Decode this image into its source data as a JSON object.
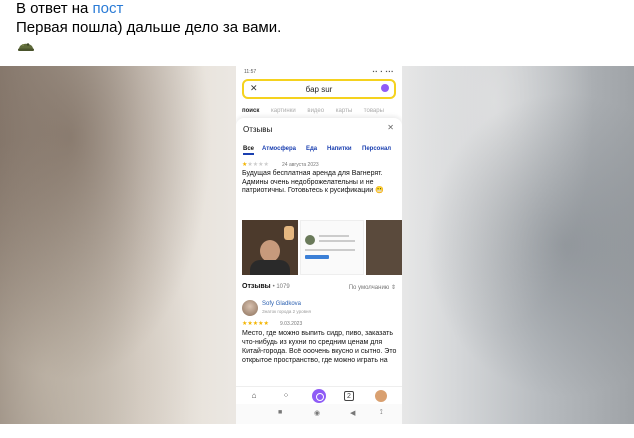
{
  "post": {
    "reply_prefix": "В ответ на",
    "reply_link": "пост",
    "text": "Первая пошла) дальше дело за вами.",
    "emoji_icon": "military-helmet-icon"
  },
  "phone": {
    "status_time": "11:57",
    "status_icons": "▪▪ ▪ ▪▪▪",
    "search": {
      "query": "бар sur",
      "clear_icon": "✕"
    },
    "tabs": [
      "поиск",
      "картинки",
      "видео",
      "карты",
      "товары"
    ],
    "sheet": {
      "title": "Отзывы",
      "close": "✕",
      "filters": [
        "Все",
        "Атмосфера",
        "Еда",
        "Напитки",
        "Персонал"
      ],
      "review1": {
        "stars_filled": "★",
        "stars_empty": "★★★★",
        "date": "24 августа 2023",
        "text": "Будущая бесплатная аренда для Вагнерят.\nАдмины очень недоброжелательны и не патриотичны. Готовьтесь к русификации",
        "emoji": "😬"
      },
      "reviews_label": "Отзывы",
      "reviews_count": "• 1079",
      "sort_label": "По умолчанию ⇕",
      "review2": {
        "author": "Sofy Gladkova",
        "author_sub": "Знаток города 2 уровня",
        "stars": "★★★★★",
        "date": "9.03.2023",
        "text": "Место, где можно выпить сидр, пиво, заказать что-нибудь из кухни по средним ценам для Китай-города. Всё ооочень вкусно и сытно. Это открытое пространство, где можно играть на"
      }
    },
    "nav": {
      "home": "⌂",
      "apps": "⁘",
      "tabs_count": "2",
      "system_square": "■",
      "system_circle": "◉",
      "system_back": "◀",
      "system_extra": "⟟"
    }
  },
  "colors": {
    "link": "#2a7bd6",
    "search_border": "#f5d21e",
    "stars": "#f3b400",
    "filter_text": "#1a3fb0",
    "alice": "#8f5cf6"
  }
}
